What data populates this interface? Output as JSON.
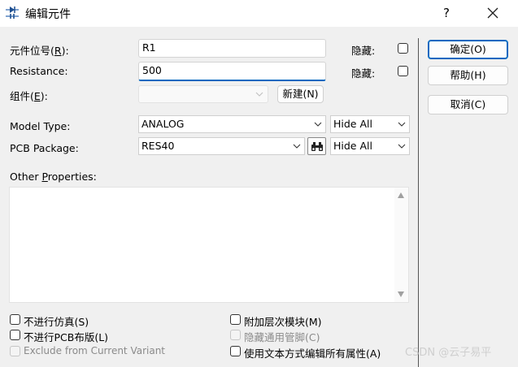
{
  "window": {
    "title": "编辑元件",
    "help": "?",
    "icon": "component-icon"
  },
  "form": {
    "designator_label": "元件位号(R):",
    "designator_prefix": "元件位号(",
    "designator_key": "R",
    "designator_suffix": "):",
    "designator_value": "R1",
    "hide_label_1": "隐藏:",
    "resistance_label": "Resistance:",
    "resistance_value": "500",
    "hide_label_2": "隐藏:",
    "group_prefix": "组件(",
    "group_key": "E",
    "group_suffix": "):",
    "new_button": "新建(N)",
    "model_type_label": "Model Type:",
    "model_type_value": "ANALOG",
    "model_hide_value": "Hide All",
    "pcb_package_label": "PCB Package:",
    "pcb_package_value": "RES40",
    "pcb_hide_value": "Hide All",
    "other_prefix": "Other ",
    "other_key": "P",
    "other_suffix": "roperties:"
  },
  "options": {
    "no_simulation": "不进行仿真(S)",
    "no_pcb_layout": "不进行PCB布版(L)",
    "exclude_variant": "Exclude from Current Variant",
    "attach_hierarchy": "附加层次模块(M)",
    "hide_common_pins": "隐藏通用管脚(C)",
    "edit_as_text": "使用文本方式编辑所有属性(A)"
  },
  "actions": {
    "ok": "确定(O)",
    "help": "帮助(H)",
    "cancel": "取消(C)"
  },
  "watermark": "CSDN @云子易平"
}
